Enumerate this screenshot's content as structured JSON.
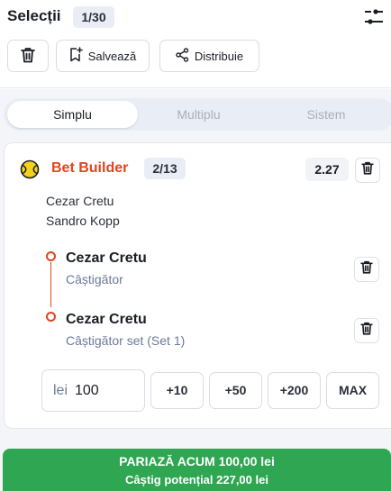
{
  "header": {
    "title": "Selecții",
    "count": "1/30"
  },
  "toolbar": {
    "save_label": "Salvează",
    "share_label": "Distribuie"
  },
  "tabs": [
    {
      "label": "Simplu",
      "active": true
    },
    {
      "label": "Multiplu",
      "active": false
    },
    {
      "label": "Sistem",
      "active": false
    }
  ],
  "bet": {
    "title": "Bet Builder",
    "count": "2/13",
    "odds": "2.27",
    "players": [
      "Cezar Cretu",
      "Sandro Kopp"
    ],
    "selections": [
      {
        "name": "Cezar Cretu",
        "market": "Câștigător"
      },
      {
        "name": "Cezar Cretu",
        "market": "Câștigător set (Set 1)"
      }
    ]
  },
  "stake": {
    "currency": "lei",
    "value": "100",
    "quick": [
      "+10",
      "+50",
      "+200",
      "MAX"
    ]
  },
  "place": {
    "label": "PARIAZĂ ACUM  100,00 lei",
    "potential": "Câștig potențial 227,00 lei"
  },
  "colors": {
    "accent": "#e0451f",
    "place_button": "#2ea652"
  }
}
